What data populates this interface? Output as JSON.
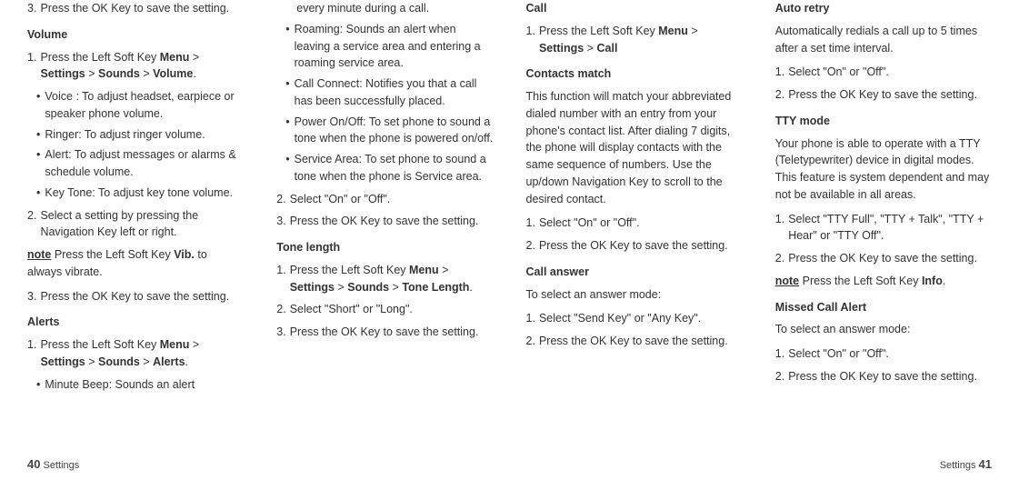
{
  "col1": {
    "step3": "Press the OK Key to save the setting.",
    "volume_heading": "Volume",
    "vol_step1_a": "Press the Left Soft Key ",
    "vol_step1_b": "Menu",
    "vol_step1_c": " > ",
    "vol_step1_d": "Settings",
    "vol_step1_e": " > ",
    "vol_step1_f": "Sounds",
    "vol_step1_g": " > ",
    "vol_step1_h": "Volume",
    "vol_step1_i": ".",
    "vol_bullet1": "Voice : To adjust headset, earpiece or speaker phone volume.",
    "vol_bullet2": "Ringer: To adjust ringer volume.",
    "vol_bullet3": "Alert: To adjust messages or alarms & schedule volume.",
    "vol_bullet4": "Key Tone: To adjust key tone volume.",
    "vol_step2": "Select a setting by pressing the Navigation Key left or right.",
    "vol_note_a": "note",
    "vol_note_b": " Press the Left Soft Key ",
    "vol_note_c": "Vib.",
    "vol_note_d": " to always vibrate.",
    "vol_step3": "Press the OK Key to save the setting.",
    "alerts_heading": "Alerts",
    "alerts_step1_a": "Press the Left Soft Key ",
    "alerts_step1_b": "Menu",
    "alerts_step1_c": " > ",
    "alerts_step1_d": "Settings",
    "alerts_step1_e": " > ",
    "alerts_step1_f": "Sounds",
    "alerts_step1_g": " > ",
    "alerts_step1_h": "Alerts",
    "alerts_step1_i": ".",
    "alerts_bullet1": "Minute Beep: Sounds an alert"
  },
  "col2": {
    "cont": "every minute during a call.",
    "bullet2": "Roaming: Sounds an alert when leaving a service area and entering a roaming service area.",
    "bullet3": "Call Connect: Notifies you that a call has been successfully placed.",
    "bullet4": "Power On/Off: To set phone to sound a tone when the phone is powered on/off.",
    "bullet5": "Service Area: To set phone to sound a tone when the phone is Service area.",
    "step2": "Select \"On\" or \"Off\".",
    "step3": "Press the OK Key to save the setting.",
    "tone_heading": "Tone length",
    "tone_step1_a": "Press the Left Soft Key ",
    "tone_step1_b": "Menu",
    "tone_step1_c": " > ",
    "tone_step1_d": "Settings",
    "tone_step1_e": " > ",
    "tone_step1_f": "Sounds",
    "tone_step1_g": " > ",
    "tone_step1_h": "Tone Length",
    "tone_step1_i": ".",
    "tone_step2": "Select \"Short\" or \"Long\".",
    "tone_step3": "Press the OK Key to save the setting."
  },
  "col3": {
    "call_heading": "Call",
    "call_step1_a": "Press the Left Soft Key ",
    "call_step1_b": "Menu",
    "call_step1_c": " > ",
    "call_step1_d": "Settings",
    "call_step1_e": " > ",
    "call_step1_f": "Call",
    "contacts_heading": "Contacts match",
    "contacts_para": "This function will match your abbreviated dialed number with an entry from your phone's contact list. After dialing 7 digits, the phone will display contacts with the same sequence of numbers. Use the up/down Navigation Key to scroll to the desired contact.",
    "contacts_step1": "Select \"On\" or \"Off\".",
    "contacts_step2": "Press the OK Key to save the setting.",
    "answer_heading": "Call answer",
    "answer_para": "To select an answer mode:",
    "answer_step1": "Select \"Send Key\" or \"Any Key\".",
    "answer_step2": "Press the OK Key to save the setting."
  },
  "col4": {
    "auto_heading": "Auto retry",
    "auto_para": "Automatically redials a call up to 5 times after a set time interval.",
    "auto_step1": "Select \"On\" or \"Off\".",
    "auto_step2": "Press the OK Key to save the setting.",
    "tty_heading": "TTY mode",
    "tty_para": "Your phone is able to operate with a TTY (Teletypewriter) device in digital modes. This feature is system dependent and may not be available in all areas.",
    "tty_step1": "Select \"TTY Full\", \"TTY + Talk\", \"TTY + Hear\" or \"TTY Off\".",
    "tty_step2": "Press the OK Key to save the setting.",
    "tty_note_a": "note",
    "tty_note_b": " Press the Left Soft Key ",
    "tty_note_c": "Info",
    "tty_note_d": ".",
    "missed_heading": "Missed Call Alert",
    "missed_para": "To select an answer mode:",
    "missed_step1": "Select \"On\" or \"Off\".",
    "missed_step2": "Press the OK Key to save the setting."
  },
  "footer": {
    "left_label": "Settings",
    "left_page": "40",
    "right_label": "Settings",
    "right_page": "41"
  }
}
